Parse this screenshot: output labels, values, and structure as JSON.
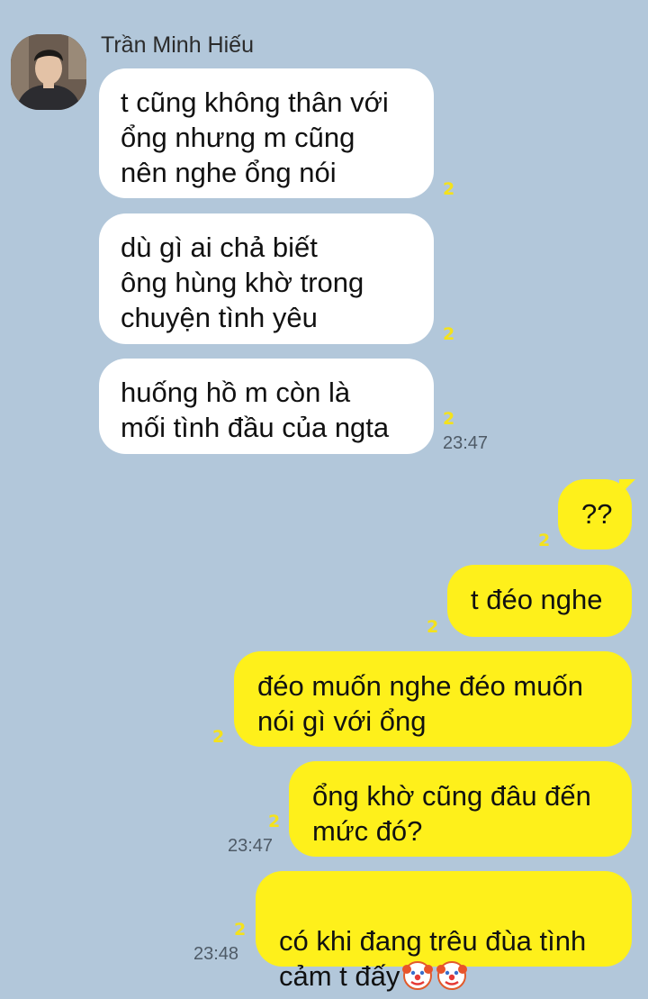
{
  "contact": {
    "name": "Trần Minh Hiếu"
  },
  "messages": [
    {
      "from": "them",
      "text": "t cũng không thân với\nổng nhưng m cũng\nnên nghe ổng nói",
      "read": "2"
    },
    {
      "from": "them",
      "text": "dù gì ai chả biết\nông hùng khờ trong\nchuyện tình yêu",
      "read": "2"
    },
    {
      "from": "them",
      "text": "huống hồ m còn là\nmối tình đầu của ngta",
      "read": "2",
      "time": "23:47"
    },
    {
      "from": "me",
      "text": "??",
      "read": "2"
    },
    {
      "from": "me",
      "text": "t đéo nghe",
      "read": "2"
    },
    {
      "from": "me",
      "text": "đéo muốn nghe đéo muốn\nnói gì với ổng",
      "read": "2"
    },
    {
      "from": "me",
      "text": "ổng khờ cũng đâu đến\nmức đó?",
      "read": "2",
      "time": "23:47"
    },
    {
      "from": "me",
      "text": "có khi đang trêu đùa tình\ncảm t đấy",
      "emoji": [
        "clown-face-emoji",
        "clown-face-emoji"
      ],
      "read": "2",
      "time": "23:48"
    }
  ],
  "colors": {
    "background": "#b2c7da",
    "incoming_bubble": "#ffffff",
    "outgoing_bubble": "#fef01b",
    "read_counter": "#f4e21c"
  }
}
